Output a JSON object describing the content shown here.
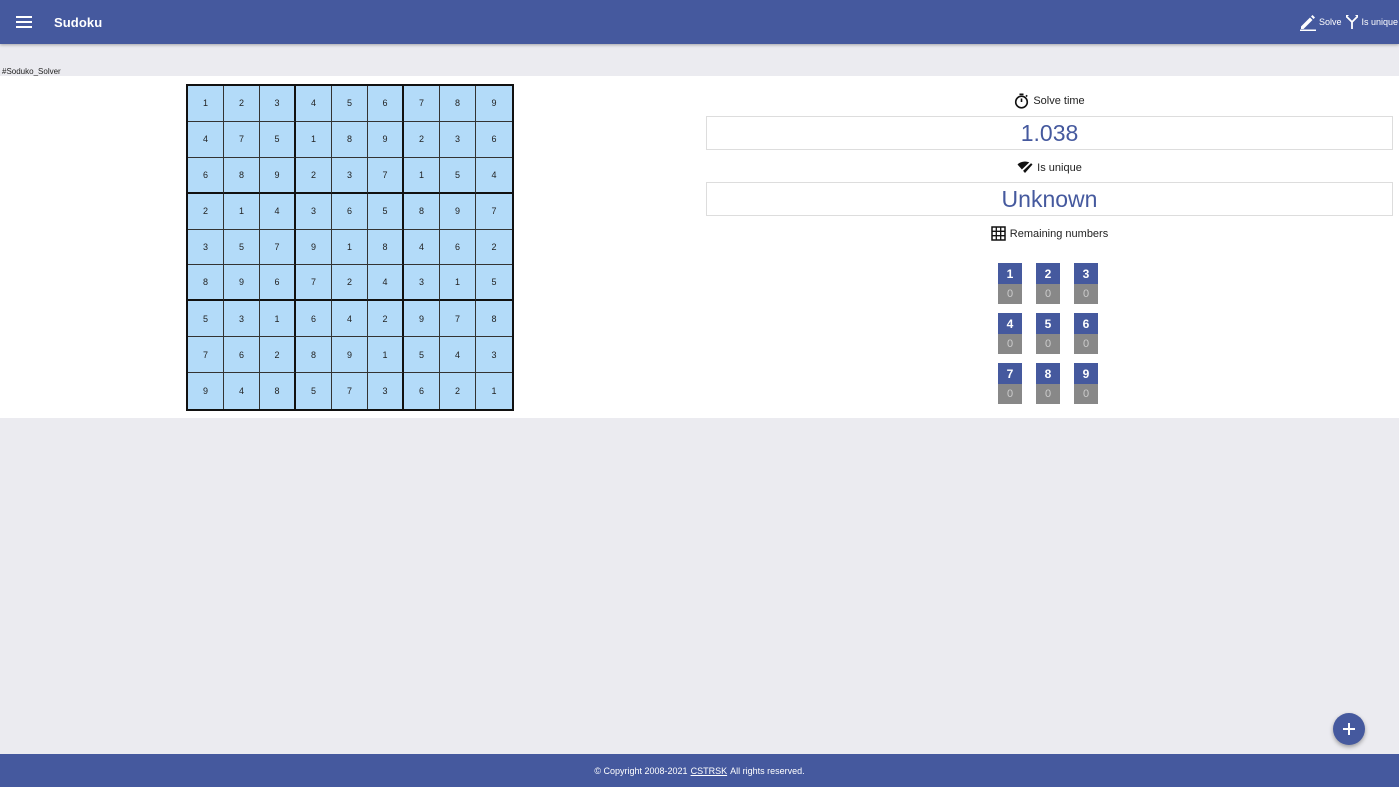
{
  "appbar": {
    "title": "Sudoku",
    "menu_icon": "menu-icon",
    "actions": [
      {
        "label": "Solve",
        "icon": "pencil-icon"
      },
      {
        "label": "Is unique",
        "icon": "fork-icon"
      }
    ]
  },
  "hashtag": "#Soduko_Solver",
  "board": [
    [
      1,
      2,
      3,
      4,
      5,
      6,
      7,
      8,
      9
    ],
    [
      4,
      7,
      5,
      1,
      8,
      9,
      2,
      3,
      6
    ],
    [
      6,
      8,
      9,
      2,
      3,
      7,
      1,
      5,
      4
    ],
    [
      2,
      1,
      4,
      3,
      6,
      5,
      8,
      9,
      7
    ],
    [
      3,
      5,
      7,
      9,
      1,
      8,
      4,
      6,
      2
    ],
    [
      8,
      9,
      6,
      7,
      2,
      4,
      3,
      1,
      5
    ],
    [
      5,
      3,
      1,
      6,
      4,
      2,
      9,
      7,
      8
    ],
    [
      7,
      6,
      2,
      8,
      9,
      1,
      5,
      4,
      3
    ],
    [
      9,
      4,
      8,
      5,
      7,
      3,
      6,
      2,
      1
    ]
  ],
  "panel": {
    "solve_time_label": "Solve time",
    "solve_time_value": "1.038",
    "unique_label": "Is unique",
    "unique_value": "Unknown",
    "remaining_label": "Remaining numbers"
  },
  "remaining": [
    {
      "num": "1",
      "count": "0"
    },
    {
      "num": "2",
      "count": "0"
    },
    {
      "num": "3",
      "count": "0"
    },
    {
      "num": "4",
      "count": "0"
    },
    {
      "num": "5",
      "count": "0"
    },
    {
      "num": "6",
      "count": "0"
    },
    {
      "num": "7",
      "count": "0"
    },
    {
      "num": "8",
      "count": "0"
    },
    {
      "num": "9",
      "count": "0"
    }
  ],
  "footer": {
    "prefix": "© Copyright 2008-2021",
    "link": "CSTRSK",
    "suffix": "All rights reserved."
  },
  "colors": {
    "primary": "#45599e",
    "cell_bg": "#b3dbf9",
    "count_bg": "#888888"
  }
}
